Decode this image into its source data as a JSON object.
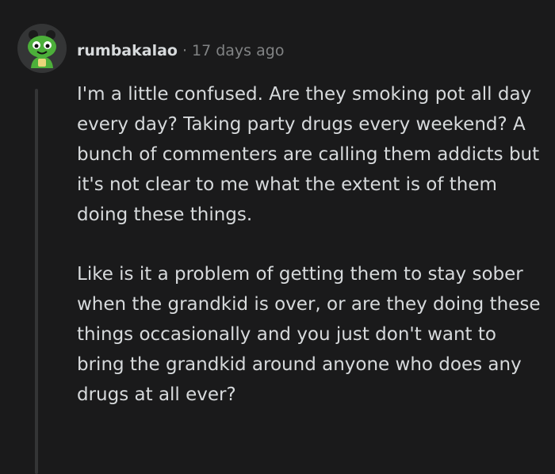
{
  "comment": {
    "author": "rumbakalao",
    "separator": "·",
    "time": "17 days ago",
    "paragraphs": [
      "I'm a little confused. Are they smoking pot all day every day? Taking party drugs every weekend? A bunch of commenters are calling them addicts but it's not clear to me what the extent is of them doing these things.",
      "Like is it a problem of getting them to stay sober when the grandkid is over, or are they doing these things occasionally and you just don't want to bring the grandkid around anyone who does any drugs at all ever?"
    ]
  },
  "colors": {
    "background": "#1a1a1b",
    "text": "#d7dadc",
    "muted": "#818384",
    "thread_line": "#343536",
    "avatar_bg": "#2f2f30",
    "avatar_green": "#4caf3a"
  },
  "icons": {
    "avatar": "green-snoo-avatar"
  }
}
